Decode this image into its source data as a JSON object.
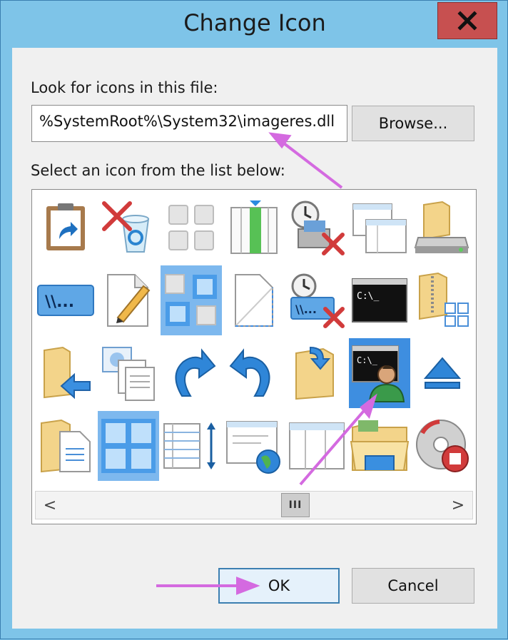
{
  "window": {
    "title": "Change Icon",
    "close_symbol": "X"
  },
  "file_section": {
    "label": "Look for icons in this file:",
    "path_value": "%SystemRoot%\\System32\\imageres.dll",
    "browse_label": "Browse..."
  },
  "list_section": {
    "label": "Select an icon from the list below:",
    "icons": [
      {
        "name": "clipboard-shortcut-icon"
      },
      {
        "name": "recycle-bin-delete-icon"
      },
      {
        "name": "gray-tiles-icon"
      },
      {
        "name": "column-pane-icon"
      },
      {
        "name": "clock-printer-x-icon"
      },
      {
        "name": "windows-stack-icon"
      },
      {
        "name": "drive-folder-icon"
      },
      {
        "name": "network-path-icon"
      },
      {
        "name": "document-pencil-icon"
      },
      {
        "name": "tiles-select-icon"
      },
      {
        "name": "blank-page-icon"
      },
      {
        "name": "clock-network-x-icon"
      },
      {
        "name": "cmd-prompt-icon"
      },
      {
        "name": "zipped-folder-icon"
      },
      {
        "name": "folder-back-arrow-icon"
      },
      {
        "name": "picture-documents-icon"
      },
      {
        "name": "redo-arrow-icon"
      },
      {
        "name": "undo-arrow-icon"
      },
      {
        "name": "folder-share-icon"
      },
      {
        "name": "cmd-user-icon"
      },
      {
        "name": "eject-icon"
      },
      {
        "name": "folder-documents-icon"
      },
      {
        "name": "blue-tiles-icon"
      },
      {
        "name": "list-resize-icon"
      },
      {
        "name": "web-window-globe-icon"
      },
      {
        "name": "table-window-icon"
      },
      {
        "name": "open-folders-icon"
      },
      {
        "name": "disc-stop-icon"
      }
    ],
    "selected_icon": "cmd-user-icon",
    "scroll_left": "<",
    "scroll_right": ">",
    "thumb_grip": "III"
  },
  "buttons": {
    "ok": "OK",
    "cancel": "Cancel"
  },
  "colors": {
    "title_bar": "#7ec4e8",
    "close": "#c75050",
    "selection": "#3e8ee0",
    "annotation_arrow": "#d46ae0"
  }
}
